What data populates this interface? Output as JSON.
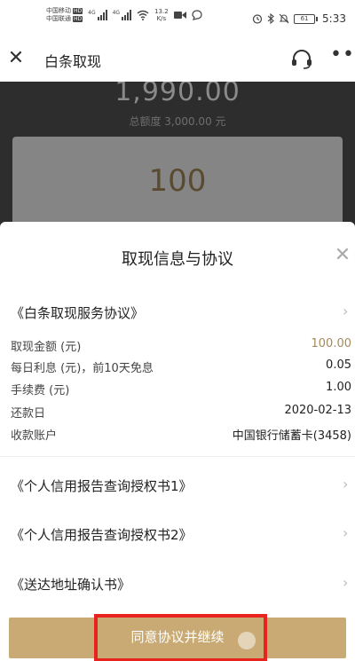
{
  "status_bar": {
    "carrier_1": "中国移动",
    "carrier_2": "中国联通",
    "hd_badge": "HD",
    "signal_tag": "4G",
    "speed_value": "13.2",
    "speed_unit": "K/s",
    "battery": "61",
    "time": "5:33"
  },
  "header": {
    "title": "白条取现"
  },
  "background": {
    "available_amount": "1,990.00",
    "total_limit": "总额度 3,000.00 元",
    "input_amount": "100"
  },
  "sheet": {
    "title": "取现信息与协议",
    "agreements": [
      {
        "label": "《白条取现服务协议》"
      },
      {
        "label": "《个人信用报告查询授权书1》"
      },
      {
        "label": "《个人信用报告查询授权书2》"
      },
      {
        "label": "《送达地址确认书》"
      }
    ],
    "info": [
      {
        "label": "取现金额 (元)",
        "value": "100.00"
      },
      {
        "label": "每日利息 (元)，前10天免息",
        "value": "0.05"
      },
      {
        "label": "手续费 (元)",
        "value": "1.00"
      },
      {
        "label": "还款日",
        "value": "2020-02-13"
      },
      {
        "label": "收款账户",
        "value": "中国银行储蓄卡(3458)"
      }
    ],
    "agree_button": "同意协议并继续"
  },
  "colors": {
    "accent_gold": "#c9aa74",
    "amount_gold": "#a38a5a",
    "highlight_red": "#e8231e"
  },
  "icons": [
    "close-icon",
    "headset-icon",
    "more-icon",
    "chevron-right-icon",
    "wifi-icon",
    "video-icon",
    "alarm-icon",
    "bluetooth-icon",
    "mute-icon"
  ]
}
